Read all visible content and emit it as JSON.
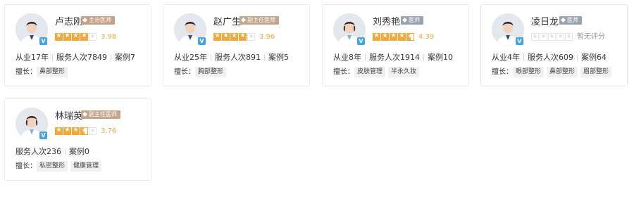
{
  "colors": {
    "star": "#f3a93a",
    "accent_blue": "#46a3e6"
  },
  "skills_label": "擅长：",
  "doctors": [
    {
      "name": "卢志刚",
      "title": "主治医师",
      "title_color": "#c79e86",
      "stars": [
        1,
        1,
        1,
        1,
        0
      ],
      "score": "3.98",
      "stats": [
        "从业17年",
        "服务人次7849",
        "案例7"
      ],
      "skills": [
        "鼻部整形"
      ],
      "verified": "V"
    },
    {
      "name": "赵广生",
      "title": "副主任医师",
      "title_color": "#c2a58a",
      "stars": [
        1,
        1,
        1,
        1,
        0
      ],
      "score": "3.96",
      "stats": [
        "从业25年",
        "服务人次891",
        "案例5"
      ],
      "skills": [
        "胸部整形"
      ],
      "verified": "V"
    },
    {
      "name": "刘秀艳",
      "title": "医师",
      "title_color": "#9aa3b2",
      "stars": [
        1,
        1,
        1,
        1,
        0.5
      ],
      "score": "4.39",
      "stats": [
        "从业8年",
        "服务人次1914",
        "案例10"
      ],
      "skills": [
        "皮肤管理",
        "半永久妆"
      ],
      "verified": "V"
    },
    {
      "name": "凌日龙",
      "title": "医师",
      "title_color": "#9aa3b2",
      "stars": [
        0,
        0,
        0,
        0,
        0
      ],
      "score": "暂无评分",
      "stats": [
        "从业4年",
        "服务人次609",
        "案例64"
      ],
      "skills": [
        "眼部整形",
        "鼻部整形",
        "眉部整形"
      ],
      "verified": "V"
    },
    {
      "name": "林瑞英",
      "title": "副主任医师",
      "title_color": "#c2a58a",
      "stars": [
        1,
        1,
        1,
        0.5,
        0
      ],
      "score": "3.76",
      "stats": [
        "服务人次236",
        "案例0"
      ],
      "skills": [
        "私密整形",
        "健康管理"
      ],
      "verified": "V"
    }
  ]
}
